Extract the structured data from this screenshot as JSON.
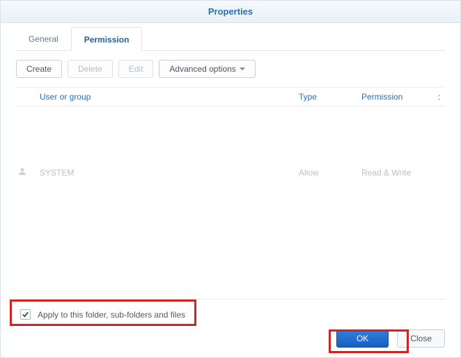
{
  "title": "Properties",
  "tabs": [
    {
      "label": "General",
      "active": false
    },
    {
      "label": "Permission",
      "active": true
    }
  ],
  "toolbar": {
    "create": "Create",
    "delete": "Delete",
    "edit": "Edit",
    "advanced": "Advanced options"
  },
  "columns": {
    "user": "User or group",
    "type": "Type",
    "permission": "Permission"
  },
  "rows": [
    {
      "user": "SYSTEM",
      "type": "Allow",
      "permission": "Read & Write"
    }
  ],
  "apply_label": "Apply to this folder, sub-folders and files",
  "apply_checked": true,
  "footer": {
    "ok": "OK",
    "close": "Close"
  }
}
